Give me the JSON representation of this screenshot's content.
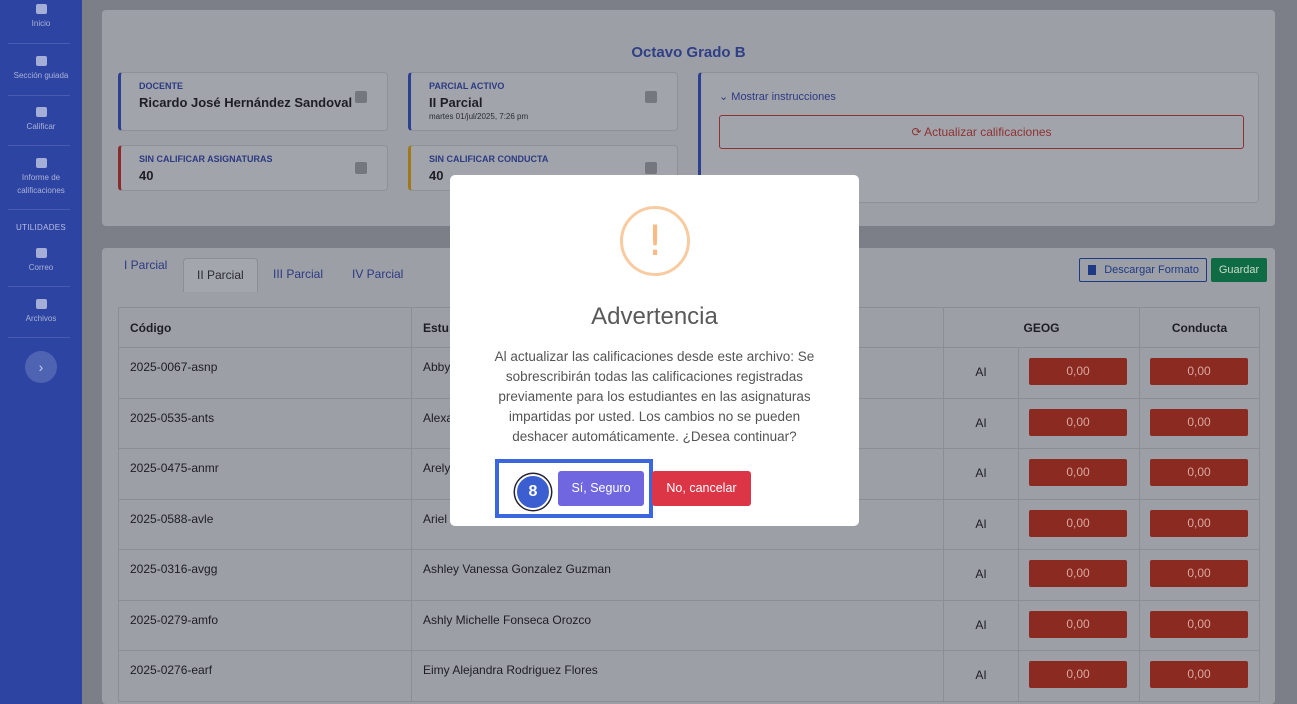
{
  "sidebar": {
    "items": [
      {
        "label": "Inicio",
        "icon": "home-icon"
      },
      {
        "label": "Sección guiada",
        "icon": "school-icon"
      },
      {
        "label": "Calificar",
        "icon": "grade-icon"
      },
      {
        "label": "Informe de calificaciones",
        "icon": "chart-icon"
      },
      {
        "label": "Correo",
        "icon": "mail-icon"
      },
      {
        "label": "Archivos",
        "icon": "archive-icon"
      }
    ],
    "section_utilities": "UTILIDADES",
    "toggle": "›"
  },
  "header": {
    "title": "Octavo Grado B",
    "docente_label": "DOCENTE",
    "docente_value": "Ricardo José Hernández Sandoval",
    "parcial_label": "PARCIAL ACTIVO",
    "parcial_value": "II Parcial",
    "parcial_date": "martes 01/jul/2025, 7:26 pm",
    "sin_asig_label": "SIN CALIFICAR ASIGNATURAS",
    "sin_asig_value": "40",
    "sin_cond_label": "SIN CALIFICAR CONDUCTA",
    "sin_cond_value": "40",
    "show_instructions": "Mostrar instrucciones",
    "update_button": "Actualizar calificaciones"
  },
  "tabs": [
    "I Parcial",
    "II Parcial",
    "III Parcial",
    "IV Parcial"
  ],
  "actions": {
    "download": "Descargar Formato",
    "save": "Guardar"
  },
  "table": {
    "headers": [
      "Código",
      "Estu",
      "GEOG",
      "Conducta"
    ],
    "rows": [
      {
        "code": "2025-0067-asnp",
        "name": "Abby",
        "ai": "AI",
        "geog": "0,00",
        "conducta": "0,00"
      },
      {
        "code": "2025-0535-ants",
        "name": "Alexa",
        "ai": "AI",
        "geog": "0,00",
        "conducta": "0,00"
      },
      {
        "code": "2025-0475-anmr",
        "name": "Arely",
        "ai": "AI",
        "geog": "0,00",
        "conducta": "0,00"
      },
      {
        "code": "2025-0588-avle",
        "name": "Ariel",
        "ai": "AI",
        "geog": "0,00",
        "conducta": "0,00"
      },
      {
        "code": "2025-0316-avgg",
        "name": "Ashley Vanessa Gonzalez Guzman",
        "ai": "AI",
        "geog": "0,00",
        "conducta": "0,00"
      },
      {
        "code": "2025-0279-amfo",
        "name": "Ashly Michelle Fonseca Orozco",
        "ai": "AI",
        "geog": "0,00",
        "conducta": "0,00"
      },
      {
        "code": "2025-0276-earf",
        "name": "Eimy Alejandra Rodriguez Flores",
        "ai": "AI",
        "geog": "0,00",
        "conducta": "0,00"
      }
    ]
  },
  "modal": {
    "icon": "!",
    "title": "Advertencia",
    "text": "Al actualizar las calificaciones desde este archivo: Se sobrescribirán todas las calificaciones registradas previamente para los estudiantes en las asignaturas impartidas por usted. Los cambios no se pueden deshacer automáticamente. ¿Desea continuar?",
    "confirm": "Sí, Seguro",
    "cancel": "No, cancelar",
    "badge": "8"
  }
}
